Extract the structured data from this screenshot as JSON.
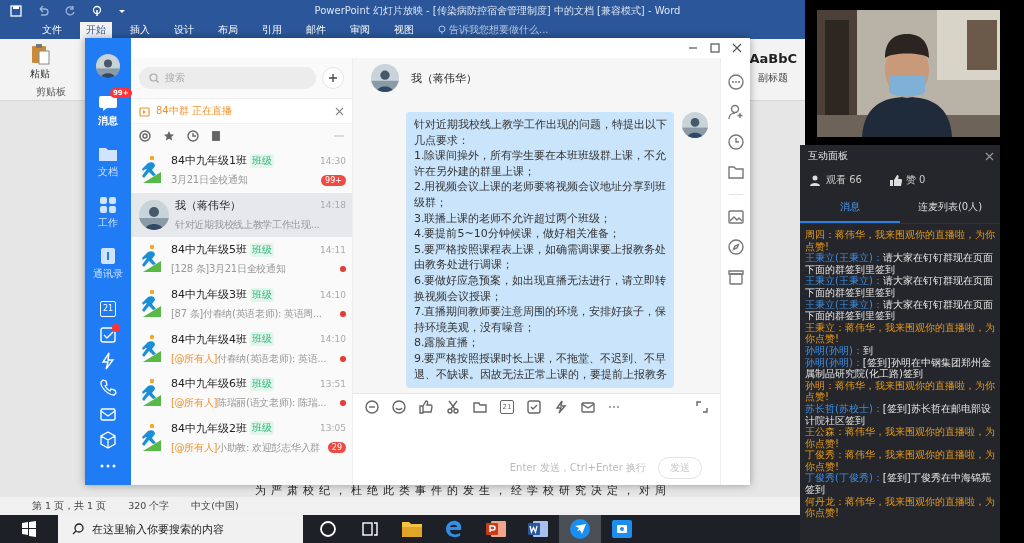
{
  "word": {
    "title": "PowerPoint 幻灯片放映 - [传染病防控宿舍管理制度] 中的文档 [兼容模式] - Word",
    "tabs": [
      {
        "label": "文件",
        "selected": false
      },
      {
        "label": "开始",
        "selected": true
      },
      {
        "label": "插入",
        "selected": false
      },
      {
        "label": "设计",
        "selected": false
      },
      {
        "label": "布局",
        "selected": false
      },
      {
        "label": "引用",
        "selected": false
      },
      {
        "label": "邮件",
        "selected": false
      },
      {
        "label": "审阅",
        "selected": false
      },
      {
        "label": "视图",
        "selected": false
      }
    ],
    "tell_me": {
      "placeholder": "告诉我您想要做什么..."
    },
    "ribbon": {
      "paste": "粘贴",
      "group": "剪贴板",
      "style_sample": "AaBbC",
      "style_name": "副标题"
    },
    "document_text": "为严肃校纪，杜绝此类事件的发生，经学校研究决定，对周",
    "status_bar": [
      "第 1 页，共 1 页",
      "320 个字",
      "中文(中国)"
    ]
  },
  "taskbar": {
    "search": {
      "placeholder": "在这里输入你要搜索的内容"
    },
    "apps": [
      {
        "kind": "cortana",
        "selected": false
      },
      {
        "kind": "taskview",
        "selected": false
      },
      {
        "kind": "explorer",
        "selected": false
      },
      {
        "kind": "edge",
        "selected": false
      },
      {
        "kind": "powerpoint",
        "selected": false
      },
      {
        "kind": "word",
        "selected": false
      },
      {
        "kind": "dingtalk",
        "selected": true
      },
      {
        "kind": "app",
        "selected": false
      }
    ]
  },
  "dingtalk": {
    "nav": [
      {
        "kind": "message",
        "label": "消息",
        "selected": true,
        "badge": "99+"
      },
      {
        "kind": "docs",
        "label": "文档",
        "selected": false
      },
      {
        "kind": "work",
        "label": "工作",
        "selected": false
      },
      {
        "kind": "contacts",
        "label": "通讯录",
        "selected": false
      }
    ],
    "nav_tools": [
      {
        "kind": "calendar",
        "text": "21"
      },
      {
        "kind": "todo",
        "dot": true
      },
      {
        "kind": "lightning"
      },
      {
        "kind": "phone"
      },
      {
        "kind": "mail"
      },
      {
        "kind": "cube"
      },
      {
        "kind": "more"
      }
    ],
    "search": {
      "placeholder": "搜索"
    },
    "live_banner": "84中群 正在直播",
    "chats": [
      {
        "kind": "group",
        "name": "84中九年级1班",
        "tag": "班级",
        "time": "14:30",
        "preview": "3月21日全校通知",
        "badge": "99+",
        "unread_dot": false,
        "selected": false
      },
      {
        "kind": "person",
        "name": "我（蒋伟华）",
        "time": "14:18",
        "preview": "针对近期我校线上教学工作出现...",
        "unread_dot": false,
        "selected": true
      },
      {
        "kind": "group",
        "name": "84中九年级5班",
        "tag": "班级",
        "time": "14:11",
        "preview": "[128 条]3月21日全校通知",
        "unread_dot": true,
        "selected": false
      },
      {
        "kind": "group",
        "name": "84中九年级3班",
        "tag": "班级",
        "time": "14:10",
        "preview": "[87 条]付春纳(英语老师): 英语周...",
        "unread_dot": true,
        "selected": false
      },
      {
        "kind": "group",
        "name": "84中九年级4班",
        "tag": "班级",
        "time": "14:10",
        "mention": "[@所有人]",
        "preview": "付春纳(英语老师): 英语...",
        "unread_dot": true,
        "selected": false
      },
      {
        "kind": "group",
        "name": "84中九年级6班",
        "tag": "班级",
        "time": "13:51",
        "mention": "[@所有人]",
        "preview": "陈瑞丽(语文老师): 陈瑞...",
        "unread_dot": true,
        "selected": false
      },
      {
        "kind": "group",
        "name": "84中九年级2班",
        "tag": "班级",
        "time": "13:05",
        "mention": "[@所有人]",
        "preview": "小助教: 欢迎彭志华入群",
        "badge": "29",
        "unread_dot": false,
        "selected": false
      }
    ],
    "chat": {
      "title": "我（蒋伟华）",
      "message": "针对近期我校线上教学工作出现的问题，特提出以下几点要求：\n1.除课间操外，所有学生要在本班班级群上课，不允许在另外建的群里上课；\n2.用视频会议上课的老师要将视频会议地址分享到班级群；\n3.联播上课的老师不允许超过两个班级；\n4.要提前5~10分钟候课，做好相关准备；\n5.要严格按照课程表上课，如确需调课要上报教务处由教务处进行调课；\n6.要做好应急预案，如出现直播无法进行，请立即转换视频会议授课；\n7.直播期间教师要注意周围的环境，安排好孩子，保持环境美观，没有噪音；\n8.露脸直播；\n9.要严格按照授课时长上课，不拖堂、不迟到、不早退、不缺课。因故无法正常上课的，要提前上报教务",
      "calendar_day": "21",
      "hint": "Enter 发送，Ctrl+Enter 换行",
      "send": {
        "label": "发送",
        "disabled": true
      }
    }
  },
  "live_panel": {
    "title": "互动面板",
    "viewers": "观看 66",
    "likes": "赞 0",
    "tabs": [
      {
        "label": "消息",
        "selected": true
      },
      {
        "label": "连麦列表(0人)",
        "selected": false
      }
    ],
    "messages": [
      {
        "kind": "like",
        "name": "周四：",
        "text": "蒋伟华，我来围观你的直播啦，为你点赞!"
      },
      {
        "kind": "chat",
        "name": "王秉立(王秉立)：",
        "text": "请大家在钉钉群现在页面下面的群签到里签到"
      },
      {
        "kind": "chat",
        "name": "王秉立(王秉立)：",
        "text": "请大家在钉钉群现在页面下面的群签到里签到"
      },
      {
        "kind": "chat",
        "name": "王秉立(王秉立)：",
        "text": "请大家在钉钉群现在页面下面的群签到里签到"
      },
      {
        "kind": "like",
        "name": "王秉立：",
        "text": "蒋伟华，我来围观你的直播啦，为你点赞!"
      },
      {
        "kind": "chat",
        "name": "孙明(孙明)：",
        "text": "到"
      },
      {
        "kind": "chat",
        "name": "孙明(孙明)：",
        "text": "[签到]孙明在中钢集团郑州金属制品研究院(化工路)签到"
      },
      {
        "kind": "like",
        "name": "孙明：",
        "text": "蒋伟华，我来围观你的直播啦，为你点赞!"
      },
      {
        "kind": "chat",
        "name": "苏长哲(苏校士)：",
        "text": "[签到]苏长哲在邮电部设计院社区签到"
      },
      {
        "kind": "like",
        "name": "王公森：",
        "text": "蒋伟华，我来围观你的直播啦，为你点赞!"
      },
      {
        "kind": "like",
        "name": "丁俊秀：",
        "text": "蒋伟华，我来围观你的直播啦，为你点赞!"
      },
      {
        "kind": "chat",
        "name": "丁俊秀(丁俊秀)：",
        "text": "[签到]丁俊秀在中海锦苑签到"
      },
      {
        "kind": "like",
        "name": "何丹龙：",
        "text": "蒋伟华，我来围观你的直播啦，为你点赞!"
      }
    ]
  }
}
